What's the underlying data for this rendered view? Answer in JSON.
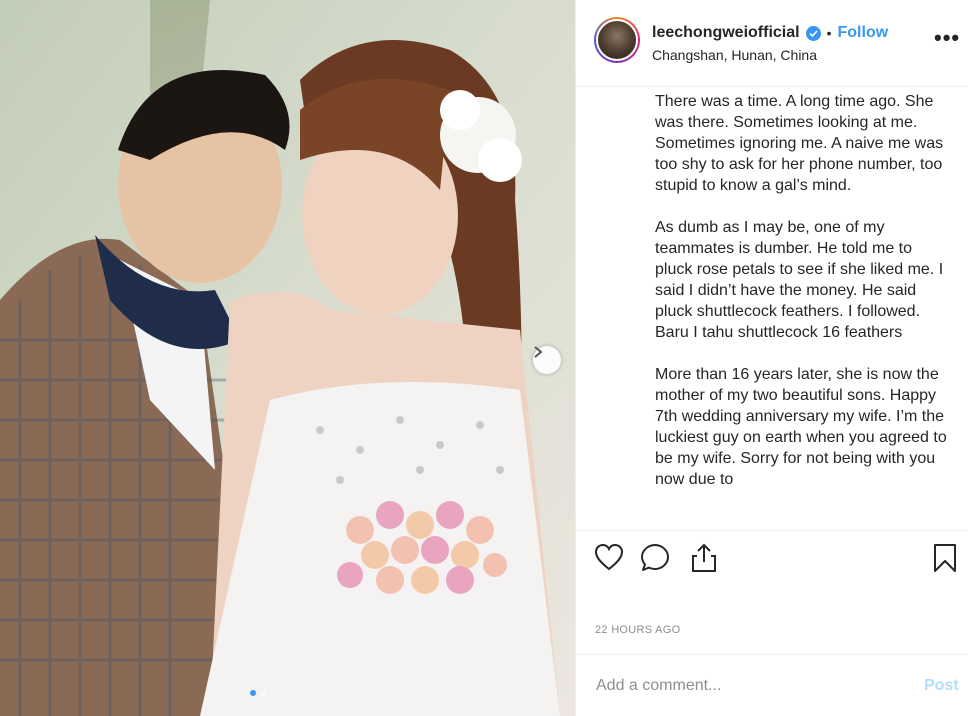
{
  "post": {
    "username": "leechongweiofficial",
    "separator": "•",
    "follow_label": "Follow",
    "location": "Changshan, Hunan, China",
    "more_label": "•••",
    "caption_paragraphs": [
      "There was a time. A long time ago. She was there. Sometimes looking at me. Sometimes ignoring me. A naive me was too shy to ask for her phone number, too stupid to know a gal’s mind.",
      "As dumb as I may be, one of my teammates is dumber. He told me to pluck rose petals to see if she liked me. I said I didn’t have the money. He said pluck shuttlecock feathers. I followed. Baru I tahu shuttlecock 16 feathers",
      "More than 16 years later, she is now the mother of my two beautiful sons. Happy 7th wedding anniversary my wife. I’m the luckiest guy on earth when you agreed to be my wife. Sorry for not being with you now due to"
    ],
    "timestamp": "22 HOURS AGO"
  },
  "comment": {
    "placeholder": "Add a comment...",
    "post_label": "Post"
  },
  "carousel": {
    "total": 2,
    "current": 1
  },
  "icons": {
    "verified": "verified-badge-icon",
    "like": "heart-icon",
    "comment": "comment-bubble-icon",
    "share": "share-icon",
    "save": "bookmark-icon",
    "next": "chevron-right-icon"
  },
  "colors": {
    "accent": "#3897f0",
    "post_disabled": "#b2dffc",
    "muted": "#8e8e8e",
    "text": "#262626"
  }
}
